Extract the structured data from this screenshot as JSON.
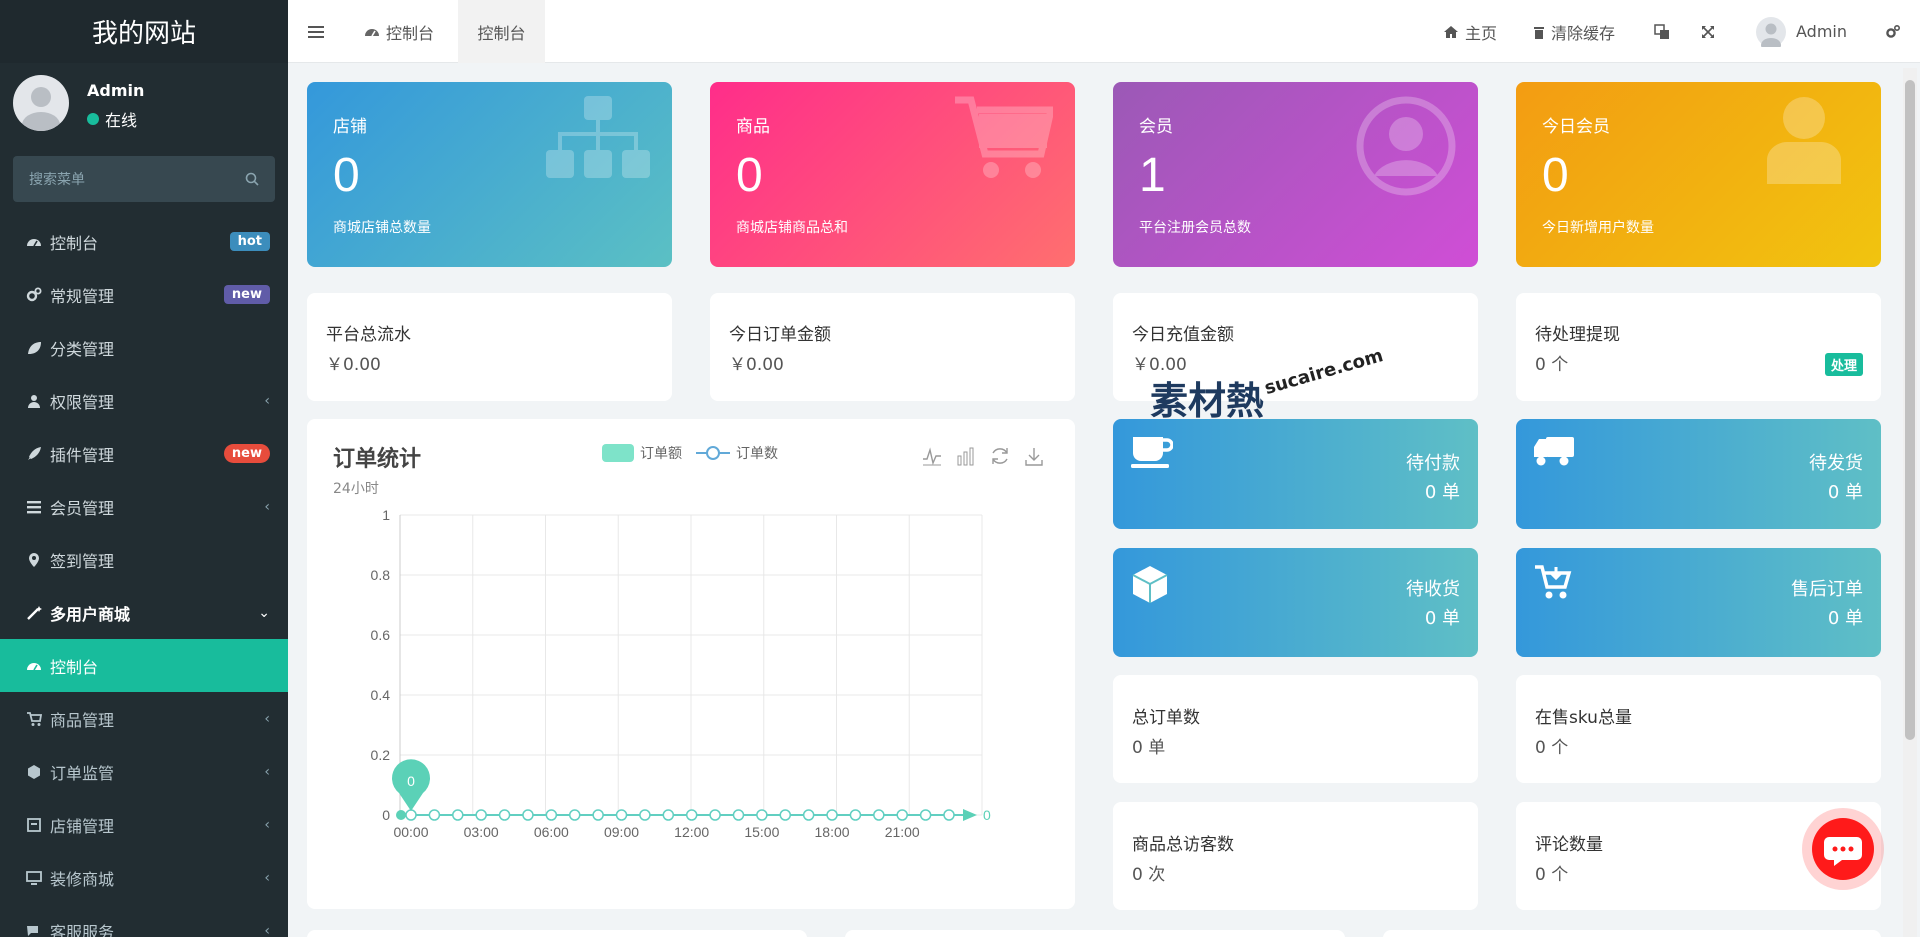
{
  "sidebar": {
    "site_title": "我的网站",
    "user": {
      "name": "Admin",
      "status": "在线"
    },
    "search_placeholder": "搜索菜单",
    "items": [
      {
        "label": "控制台",
        "badge": "hot"
      },
      {
        "label": "常规管理",
        "badge": "new"
      },
      {
        "label": "分类管理"
      },
      {
        "label": "权限管理"
      },
      {
        "label": "插件管理",
        "badge": "new"
      },
      {
        "label": "会员管理"
      },
      {
        "label": "签到管理"
      },
      {
        "label": "多用户商城"
      },
      {
        "label": "控制台"
      },
      {
        "label": "商品管理"
      },
      {
        "label": "订单监管"
      },
      {
        "label": "店铺管理"
      },
      {
        "label": "装修商城"
      },
      {
        "label": "客服服务"
      }
    ]
  },
  "topbar": {
    "tab1": "控制台",
    "tab2": "控制台",
    "home": "主页",
    "clear_cache": "清除缓存",
    "admin": "Admin"
  },
  "stats": [
    {
      "title": "店铺",
      "value": "0",
      "desc": "商城店铺总数量",
      "icon": "sitemap-icon"
    },
    {
      "title": "商品",
      "value": "0",
      "desc": "商城店铺商品总和",
      "icon": "cart-icon"
    },
    {
      "title": "会员",
      "value": "1",
      "desc": "平台注册会员总数",
      "icon": "user-circle-icon"
    },
    {
      "title": "今日会员",
      "value": "0",
      "desc": "今日新增用户数量",
      "icon": "user-icon"
    }
  ],
  "stat_colors": [
    "#3498db",
    "#ff2d8a",
    "#9b59b6",
    "#f39c12"
  ],
  "money": [
    {
      "title": "平台总流水",
      "value": "￥0.00"
    },
    {
      "title": "今日订单金额",
      "value": "￥0.00"
    },
    {
      "title": "今日充值金额",
      "value": "￥0.00"
    },
    {
      "title": "待处理提现",
      "value": "0 个",
      "action": "处理"
    }
  ],
  "order_status": [
    {
      "label": "待付款",
      "value": "0 单",
      "icon": "coffee-icon"
    },
    {
      "label": "待发货",
      "value": "0 单",
      "icon": "truck-icon"
    },
    {
      "label": "待收货",
      "value": "0 单",
      "icon": "cube-icon"
    },
    {
      "label": "售后订单",
      "value": "0 单",
      "icon": "cart-arrow-icon"
    }
  ],
  "counts": [
    {
      "title": "总订单数",
      "value": "0 单"
    },
    {
      "title": "在售sku总量",
      "value": "0 个"
    },
    {
      "title": "商品总访客数",
      "value": "0 次"
    },
    {
      "title": "评论数量",
      "value": "0 个"
    }
  ],
  "chart_panel": {
    "title": "订单统计",
    "subtitle": "24小时"
  },
  "watermark": {
    "cn": "素材熱",
    "en": "sucaire.com"
  },
  "chart_data": {
    "type": "line",
    "title": "订单统计",
    "subtitle": "24小时",
    "legend": [
      "订单额",
      "订单数"
    ],
    "legend_position": "top-center",
    "x": [
      "00:00",
      "01:00",
      "02:00",
      "03:00",
      "04:00",
      "05:00",
      "06:00",
      "07:00",
      "08:00",
      "09:00",
      "10:00",
      "11:00",
      "12:00",
      "13:00",
      "14:00",
      "15:00",
      "16:00",
      "17:00",
      "18:00",
      "19:00",
      "20:00",
      "21:00",
      "22:00",
      "23:00"
    ],
    "x_tick_labels": [
      "00:00",
      "03:00",
      "06:00",
      "09:00",
      "12:00",
      "15:00",
      "18:00",
      "21:00"
    ],
    "y_ticks": [
      "0",
      "0.2",
      "0.4",
      "0.6",
      "0.8",
      "1"
    ],
    "ylim": [
      0,
      1
    ],
    "series": [
      {
        "name": "订单数",
        "values": [
          0,
          0,
          0,
          0,
          0,
          0,
          0,
          0,
          0,
          0,
          0,
          0,
          0,
          0,
          0,
          0,
          0,
          0,
          0,
          0,
          0,
          0,
          0,
          0
        ]
      }
    ],
    "max_marker": "0",
    "end_label": "0",
    "grid": true,
    "colors": {
      "line": "#61cfc1",
      "marker": "#5bd1b7"
    }
  }
}
